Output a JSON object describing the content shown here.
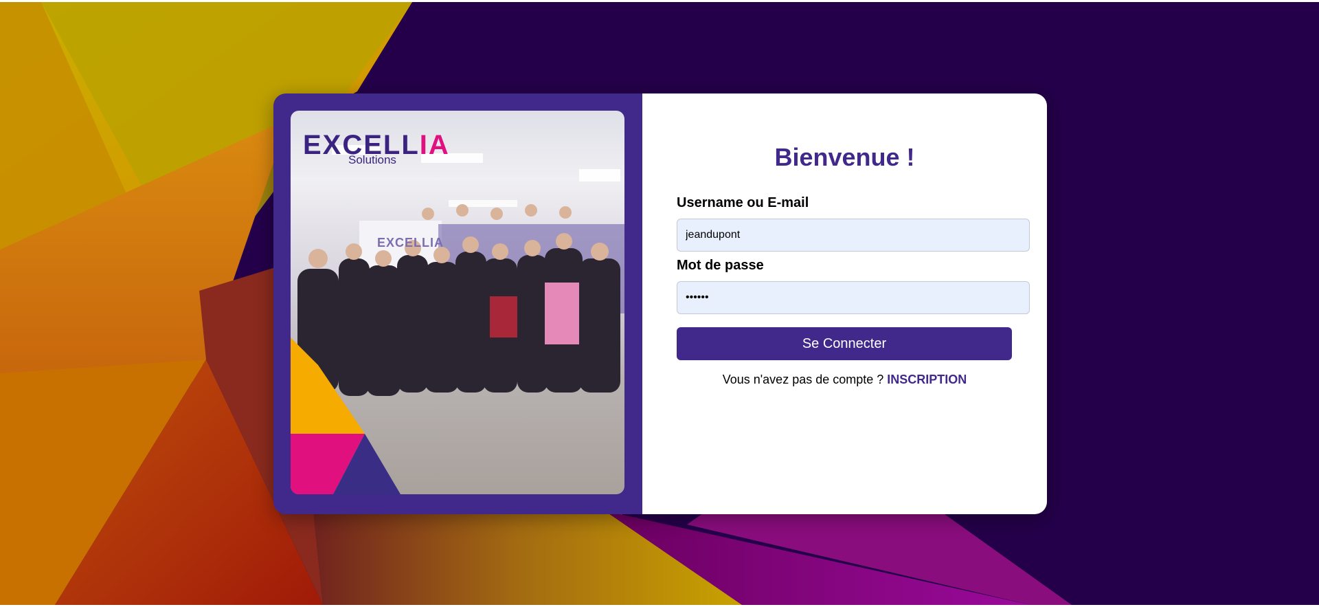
{
  "brand": {
    "logo_main_prefix": "EXCELL",
    "logo_main_suffix": "IA",
    "logo_sub": "Solutions",
    "wall_logo": "EXCELLIA",
    "colors": {
      "primary": "#41288b",
      "accent_pink": "#e0117e",
      "accent_yellow": "#f6ab00",
      "background": "#24004a",
      "input_bg": "#e8f0fe"
    }
  },
  "login": {
    "title": "Bienvenue !",
    "username_label": "Username ou E-mail",
    "username_value": "jeandupont",
    "password_label": "Mot de passe",
    "password_value": "••••••",
    "submit_label": "Se Connecter",
    "signup_prompt": "Vous n'avez pas de compte ?",
    "signup_link": "INSCRIPTION"
  },
  "photo": {
    "icon": "team-photo"
  }
}
